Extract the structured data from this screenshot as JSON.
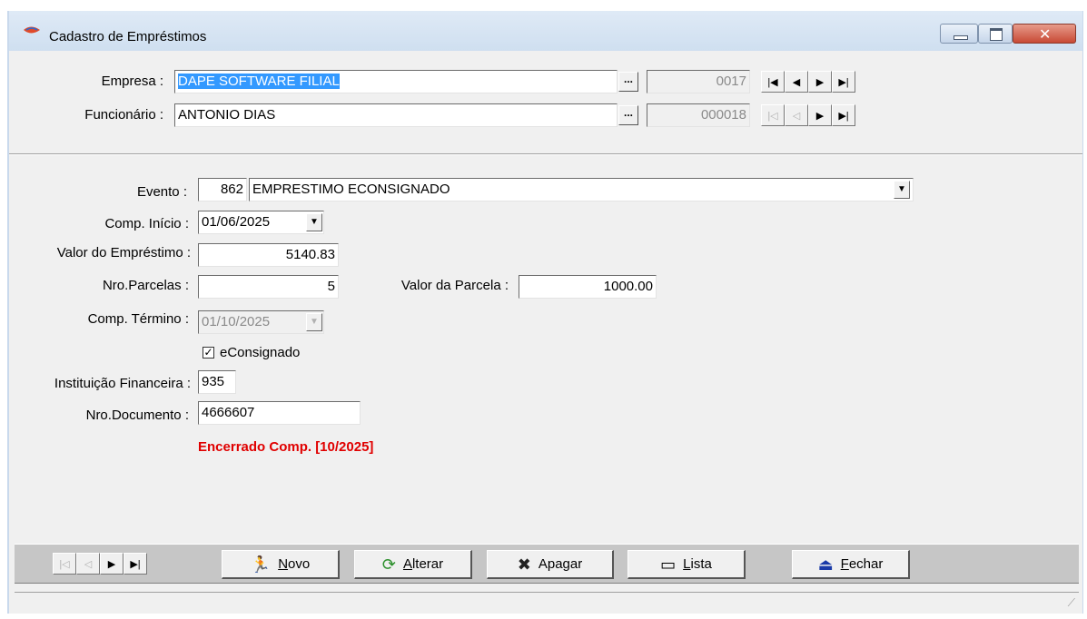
{
  "window": {
    "title": "Cadastro de Empréstimos"
  },
  "empresa": {
    "label": "Empresa :",
    "value": "DAPE SOFTWARE FILIAL",
    "code": "0017"
  },
  "funcionario": {
    "label": "Funcionário :",
    "value": "ANTONIO DIAS",
    "code": "000018"
  },
  "lookup_button": "...",
  "evento": {
    "label": "Evento :",
    "code": "862",
    "value": "EMPRESTIMO ECONSIGNADO"
  },
  "comp_inicio": {
    "label": "Comp. Início :",
    "value": "01/06/2025"
  },
  "valor_emprestimo": {
    "label": "Valor do Empréstimo :",
    "value": "5140.83"
  },
  "nro_parcelas": {
    "label": "Nro.Parcelas :",
    "value": "5"
  },
  "valor_parcela": {
    "label": "Valor da Parcela :",
    "value": "1000.00"
  },
  "comp_termino": {
    "label": "Comp. Término :",
    "value": "01/10/2025"
  },
  "econsignado": {
    "label": "eConsignado",
    "checked": true
  },
  "instituicao": {
    "label": "Instituição Financeira :",
    "value": "935"
  },
  "nro_documento": {
    "label": "Nro.Documento :",
    "value": "4666607"
  },
  "status_message": "Encerrado Comp. [10/2025]",
  "toolbar": {
    "novo": {
      "underline": "N",
      "rest": "ovo",
      "icon": "walking-man-icon"
    },
    "alterar": {
      "underline": "A",
      "rest": "lterar",
      "icon": "refresh-icon"
    },
    "apagar": {
      "label": "Apagar",
      "icon": "x-delete-icon"
    },
    "lista": {
      "underline": "L",
      "rest": "ista",
      "icon": "list-frame-icon"
    },
    "fechar": {
      "underline": "F",
      "rest": "echar",
      "icon": "exit-door-icon"
    }
  },
  "colors": {
    "selection": "#3399ff",
    "warning": "#e00000",
    "toolbar_bg": "#c6c6c6"
  }
}
